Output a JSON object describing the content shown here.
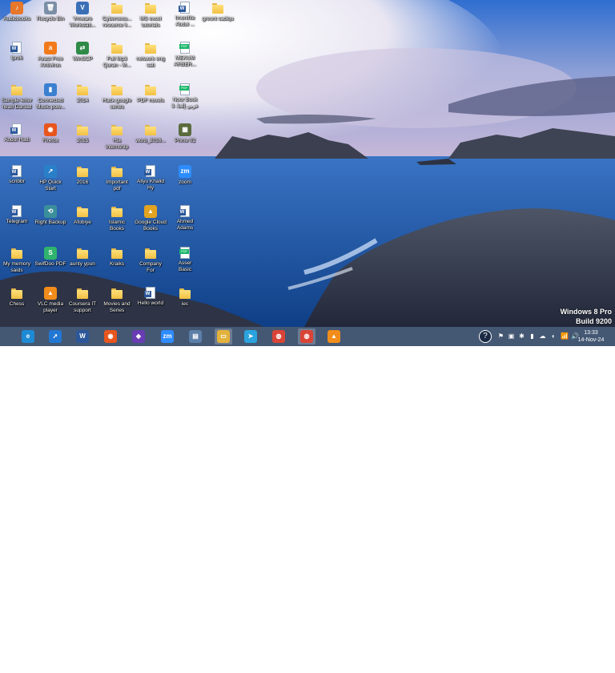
{
  "desktop": {
    "icons": [
      {
        "label": "Audiobooks",
        "kind": "app",
        "glyph": "♪",
        "color": "#e7772a"
      },
      {
        "label": "Recycle Bin",
        "kind": "app",
        "glyph": "🗑",
        "color": "#7b8fa6"
      },
      {
        "label": "Vmware\nWorkstati...",
        "kind": "app",
        "glyph": "V",
        "color": "#3a6fb6"
      },
      {
        "label": "Cybersecu...\nresource li...",
        "kind": "folder"
      },
      {
        "label": "MS excel\ntutorials",
        "kind": "folder"
      },
      {
        "label": "Imonifite\nAbdul ...",
        "kind": "doc"
      },
      {
        "label": "gresnt sadiqu",
        "kind": "folder"
      },
      {
        "label": "lpro6",
        "kind": "doc"
      },
      {
        "label": "Avast Free\nAntivirus",
        "kind": "app",
        "glyph": "a",
        "color": "#f27a1a"
      },
      {
        "label": "WinSCP",
        "kind": "app",
        "glyph": "⇄",
        "color": "#2f8a48"
      },
      {
        "label": "Full Mp3\nQuran - M...",
        "kind": "folder"
      },
      {
        "label": "network eng\nsati",
        "kind": "folder"
      },
      {
        "label": "MEKUM\nARBER...",
        "kind": "pdf"
      },
      {
        "label": "Sample letter\nhead Daniad",
        "kind": "folder"
      },
      {
        "label": "Connected\nMusic pow...",
        "kind": "app",
        "glyph": "▮",
        "color": "#3a7fd0"
      },
      {
        "label": "2014",
        "kind": "folder"
      },
      {
        "label": "Hack google\nsenes",
        "kind": "folder"
      },
      {
        "label": "PDF novels",
        "kind": "folder"
      },
      {
        "label": "Noor Book\n3 .عربي إلخا",
        "kind": "pdf"
      },
      {
        "label": "Abdul Hadi",
        "kind": "doc"
      },
      {
        "label": "Firefox",
        "kind": "app",
        "glyph": "◉",
        "color": "#e8551d"
      },
      {
        "label": "2015",
        "kind": "folder"
      },
      {
        "label": "Hia\ninternship",
        "kind": "folder"
      },
      {
        "label": "word_2016...",
        "kind": "folder"
      },
      {
        "label": "Prime 02",
        "kind": "app",
        "glyph": "▦",
        "color": "#5a6b3c"
      },
      {
        "label": "scribbr",
        "kind": "doc"
      },
      {
        "label": "HP Quick\nStart",
        "kind": "app",
        "glyph": "↗",
        "color": "#2a7fc9"
      },
      {
        "label": "2016",
        "kind": "folder"
      },
      {
        "label": "Important\npdf",
        "kind": "folder"
      },
      {
        "label": "Aliyu Khalid\nHy",
        "kind": "doc"
      },
      {
        "label": "zoom",
        "kind": "app",
        "glyph": "zm",
        "color": "#2d8cff"
      },
      {
        "label": "Telegram",
        "kind": "doc"
      },
      {
        "label": "Right Backup",
        "kind": "app",
        "glyph": "⟲",
        "color": "#3b8f9b"
      },
      {
        "label": "Afobiye",
        "kind": "folder"
      },
      {
        "label": "Islamic\nBooks",
        "kind": "folder"
      },
      {
        "label": "Google Cloud\nBooks",
        "kind": "app",
        "glyph": "▲",
        "color": "#e2a320"
      },
      {
        "label": "Ahmed\nAdams",
        "kind": "doc"
      },
      {
        "label": "My memory\nsaids",
        "kind": "folder"
      },
      {
        "label": "SwifDoo PDF",
        "kind": "app",
        "glyph": "S",
        "color": "#2fb36d"
      },
      {
        "label": "aunty ypun",
        "kind": "folder"
      },
      {
        "label": "Kraiks",
        "kind": "folder"
      },
      {
        "label": "Company\nFor",
        "kind": "folder"
      },
      {
        "label": "Asser\nBasic",
        "kind": "pdf"
      },
      {
        "label": "Chess",
        "kind": "folder"
      },
      {
        "label": "VLC media\nplayer",
        "kind": "app",
        "glyph": "▲",
        "color": "#f28c1a"
      },
      {
        "label": "Coursera IT\nsupport",
        "kind": "folder"
      },
      {
        "label": "Movies and\nSeries",
        "kind": "folder"
      },
      {
        "label": "Hello world",
        "kind": "doc"
      },
      {
        "label": "iec",
        "kind": "folder"
      }
    ]
  },
  "taskbar": {
    "apps": [
      {
        "name": "Internet Explorer",
        "glyph": "e",
        "color": "#1e8ad6"
      },
      {
        "name": "Send",
        "glyph": "➚",
        "color": "#2277d3"
      },
      {
        "name": "Word",
        "glyph": "W",
        "color": "#2b579a"
      },
      {
        "name": "Firefox",
        "glyph": "◉",
        "color": "#e8551d"
      },
      {
        "name": "Visual Studio",
        "glyph": "◆",
        "color": "#6a3cb3"
      },
      {
        "name": "Zoom",
        "glyph": "zm",
        "color": "#2d8cff"
      },
      {
        "name": "Documents",
        "glyph": "▤",
        "color": "#5b7fa8"
      },
      {
        "name": "File Explorer",
        "glyph": "▭",
        "color": "#e2b23c"
      },
      {
        "name": "Telegram",
        "glyph": "➤",
        "color": "#2aa3de"
      },
      {
        "name": "Chrome",
        "glyph": "◍",
        "color": "#d94437"
      },
      {
        "name": "Chrome",
        "glyph": "◍",
        "color": "#d94437"
      },
      {
        "name": "VLC",
        "glyph": "▲",
        "color": "#f28c1a"
      }
    ],
    "tray": [
      "?",
      "⚑",
      "▣",
      "✱",
      "▮",
      "☁",
      "◖",
      "📶",
      "🔊"
    ],
    "time": "13:33",
    "date": "14-Nov-24"
  },
  "watermark": {
    "edition": "Windows 8 Pro",
    "build": "Build 9200"
  },
  "colors": {
    "taskbar": "#344a68",
    "sky_top": "#2c6fcf",
    "sea": "#1f5aa8"
  }
}
